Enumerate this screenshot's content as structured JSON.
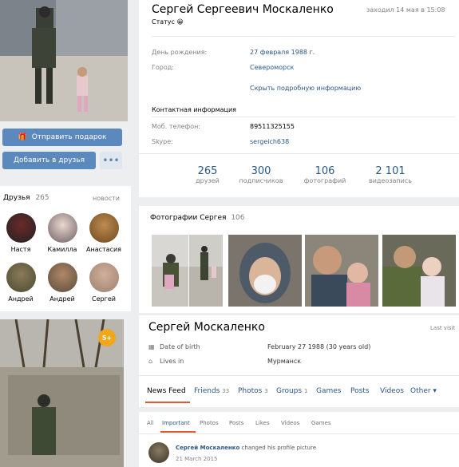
{
  "left": {
    "gift_button": "Отправить подарок",
    "add_friend_button": "Добавить в друзья",
    "more_button": "•••",
    "friends_title": "Друзья",
    "friends_count": "265",
    "friends_news": "новости",
    "friends": [
      "Настя",
      "Камилла",
      "Анастасия",
      "Андрей",
      "Андрей",
      "Сергей"
    ],
    "photo_badge": "5+"
  },
  "profile": {
    "name": "Сергей Сергеевич Москаленко",
    "last_seen": "заходил 14 мая в 15:08",
    "status": "Статус 😀",
    "birthday_label": "День рождения:",
    "birthday_value": "27 февраля 1988 г.",
    "city_label": "Город:",
    "city_value": "Североморск",
    "more_info": "Скрыть подробную информацию",
    "contacts_title": "Контактная информация",
    "phone_label": "Моб. телефон:",
    "phone_value": "89511325155",
    "skype_label": "Skype:",
    "skype_value": "sergeich638",
    "stats": [
      {
        "num": "265",
        "label": "друзей"
      },
      {
        "num": "300",
        "label": "подписчиков"
      },
      {
        "num": "106",
        "label": "фотографий"
      },
      {
        "num": "2 101",
        "label": "видеозапись"
      }
    ]
  },
  "photos": {
    "title": "Фотографии Сергея",
    "count": "106"
  },
  "profile2": {
    "name": "Сергей Москаленко",
    "last_visit": "Last visit",
    "birth_label": "Date of birth",
    "birth_value": "February 27 1988 (30 years old)",
    "lives_label": "Lives in",
    "lives_value": "Мурманск",
    "tabs": [
      {
        "label": "News Feed",
        "count": ""
      },
      {
        "label": "Friends",
        "count": "33"
      },
      {
        "label": "Photos",
        "count": "3"
      },
      {
        "label": "Groups",
        "count": "1"
      },
      {
        "label": "Games",
        "count": ""
      },
      {
        "label": "Posts",
        "count": ""
      },
      {
        "label": "Videos",
        "count": ""
      },
      {
        "label": "Other ▾",
        "count": ""
      }
    ],
    "subtabs": [
      "All",
      "Important",
      "Photos",
      "Posts",
      "Likes",
      "Videos",
      "Games"
    ],
    "feed_author": "Сергей Москаленко",
    "feed_action": "changed his profile picture",
    "feed_date": "21 March 2015"
  }
}
